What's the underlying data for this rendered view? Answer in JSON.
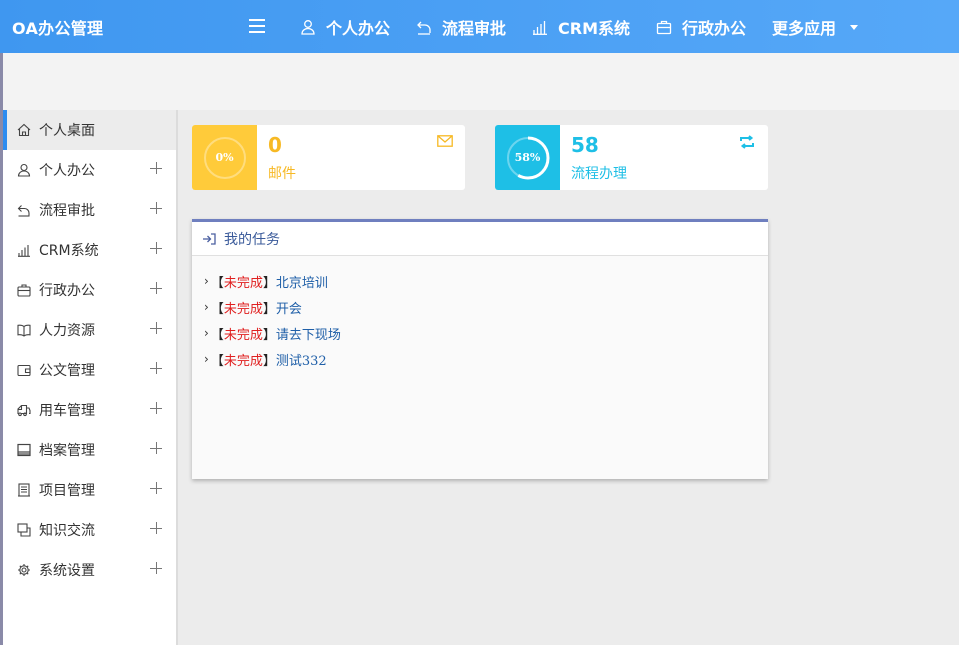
{
  "header": {
    "brand": "OA办公管理",
    "nav": [
      {
        "label": "个人办公",
        "icon": "user-icon"
      },
      {
        "label": "流程审批",
        "icon": "share-icon"
      },
      {
        "label": "CRM系统",
        "icon": "bar-chart-icon"
      },
      {
        "label": "行政办公",
        "icon": "briefcase-icon"
      },
      {
        "label": "更多应用",
        "icon": "caret-down-icon"
      }
    ]
  },
  "sidebar": {
    "items": [
      {
        "label": "个人桌面",
        "icon": "home-icon",
        "active": true
      },
      {
        "label": "个人办公",
        "icon": "user-icon"
      },
      {
        "label": "流程审批",
        "icon": "share-icon"
      },
      {
        "label": "CRM系统",
        "icon": "bar-chart-icon"
      },
      {
        "label": "行政办公",
        "icon": "briefcase-icon"
      },
      {
        "label": "人力资源",
        "icon": "book-icon"
      },
      {
        "label": "公文管理",
        "icon": "wallet-icon"
      },
      {
        "label": "用车管理",
        "icon": "truck-icon"
      },
      {
        "label": "档案管理",
        "icon": "archive-icon"
      },
      {
        "label": "项目管理",
        "icon": "list-icon"
      },
      {
        "label": "知识交流",
        "icon": "copy-icon"
      },
      {
        "label": "系统设置",
        "icon": "gear-icon"
      }
    ]
  },
  "cards": {
    "mail": {
      "percent": "0%",
      "count": "0",
      "label": "邮件",
      "color": "#ffcb3a",
      "progress": 0
    },
    "flow": {
      "percent": "58%",
      "count": "58",
      "label": "流程办理",
      "color": "#1ebfe6",
      "progress": 0.58
    }
  },
  "tasks": {
    "title": "我的任务",
    "items": [
      {
        "status": "未完成",
        "name": "北京培训"
      },
      {
        "status": "未完成",
        "name": "开会"
      },
      {
        "status": "未完成",
        "name": "请去下现场"
      },
      {
        "status": "未完成",
        "name": "测试332"
      }
    ],
    "bracket_open": "【",
    "bracket_close": "】",
    "chevron": "›"
  }
}
